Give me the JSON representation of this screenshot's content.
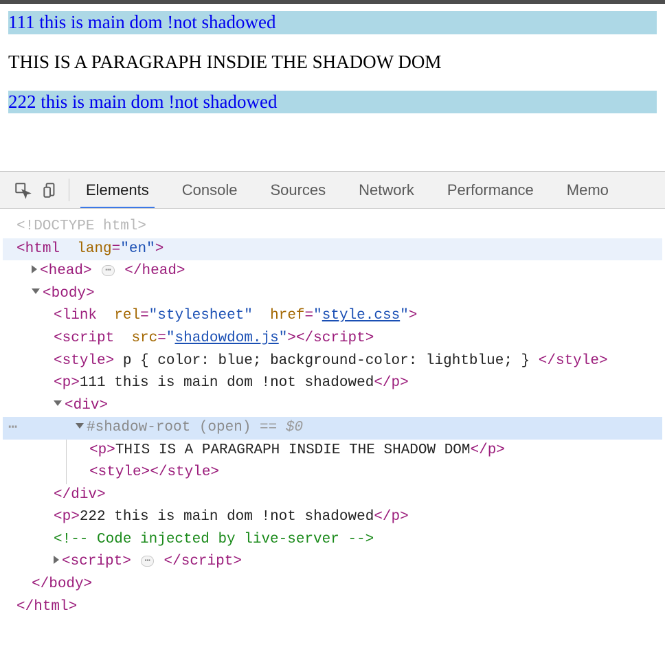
{
  "page": {
    "p1": "111 this is main dom !not shadowed",
    "pShadow": "THIS IS A PARAGRAPH INSDIE THE SHADOW DOM",
    "p2": "222 this is main dom !not shadowed"
  },
  "devtools": {
    "tabs": {
      "elements": "Elements",
      "console": "Console",
      "sources": "Sources",
      "network": "Network",
      "performance": "Performance",
      "memory": "Memo"
    },
    "code": {
      "doctype": "<!DOCTYPE html>",
      "htmlOpen_tag": "html",
      "htmlOpen_attr": "lang",
      "htmlOpen_val": "\"en\"",
      "headOpen": "head",
      "headClose": "/head",
      "bodyOpen": "body",
      "link_tag": "link",
      "link_attrRel": "rel",
      "link_valRel": "\"stylesheet\"",
      "link_attrHref": "href",
      "link_valHref": "style.css",
      "script_tag": "script",
      "script_attrSrc": "src",
      "script_valSrc": "shadowdom.js",
      "scriptClose": "/script",
      "style_tag": "style",
      "style_inner": " p { color: blue; background-color: lightblue; } ",
      "styleClose": "/style",
      "p_tag": "p",
      "pClose": "/p",
      "p1_text": "111 this is main dom !not shadowed",
      "div_tag": "div",
      "divClose": "/div",
      "shadowRoot": "#shadow-root (open)",
      "eqDollar": " == $0",
      "pShadow_text": "THIS IS A PARAGRAPH INSDIE THE SHADOW DOM",
      "styleEmptyOpen": "style",
      "styleEmptyClose": "/style",
      "p2_text": "222 this is main dom !not shadowed",
      "comment": "<!-- Code injected by live-server -->",
      "bodyClose": "/body",
      "htmlClose": "/html",
      "ellipsis": "⋯"
    }
  }
}
